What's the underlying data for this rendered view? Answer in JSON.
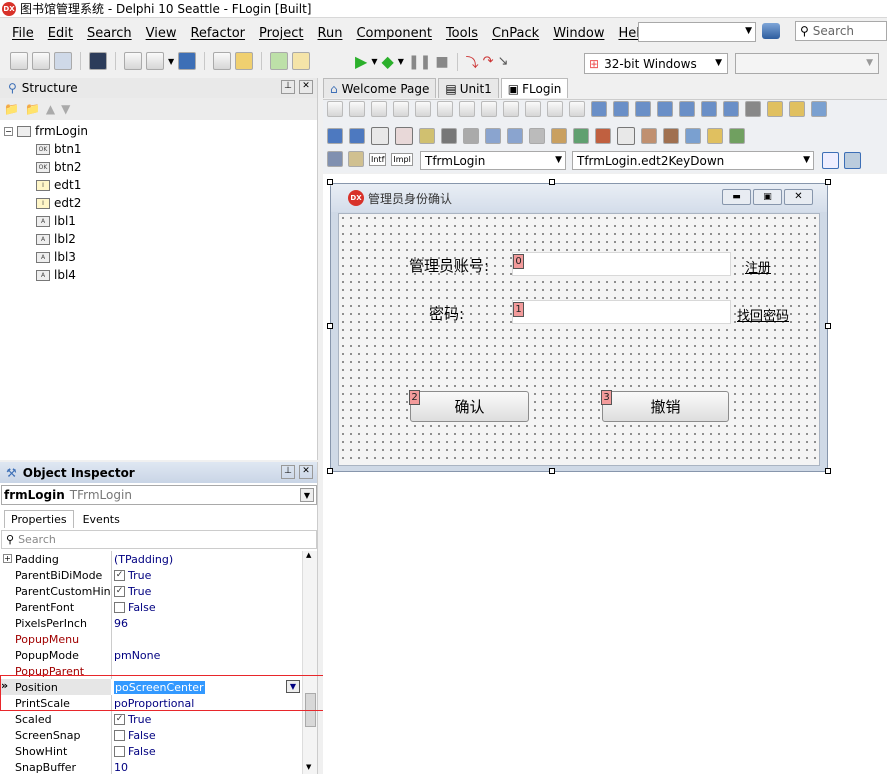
{
  "window": {
    "title": "图书馆管理系统 - Delphi 10 Seattle - FLogin [Built]",
    "app_icon_text": "DX"
  },
  "menu": [
    "File",
    "Edit",
    "Search",
    "View",
    "Refactor",
    "Project",
    "Run",
    "Component",
    "Tools",
    "CnPack",
    "Window",
    "Help"
  ],
  "search": {
    "placeholder": "Search"
  },
  "platform": {
    "selected": "32-bit Windows"
  },
  "structure": {
    "title": "Structure",
    "root": "frmLogin",
    "children": [
      {
        "name": "btn1",
        "icon": "OK"
      },
      {
        "name": "btn2",
        "icon": "OK"
      },
      {
        "name": "edt1",
        "icon": "I"
      },
      {
        "name": "edt2",
        "icon": "I"
      },
      {
        "name": "lbl1",
        "icon": "A"
      },
      {
        "name": "lbl2",
        "icon": "A"
      },
      {
        "name": "lbl3",
        "icon": "A"
      },
      {
        "name": "lbl4",
        "icon": "A"
      }
    ]
  },
  "object_inspector": {
    "title": "Object Inspector",
    "selected_object": "frmLogin",
    "selected_type": "TFrmLogin",
    "tabs": [
      "Properties",
      "Events"
    ],
    "search_placeholder": "Search",
    "properties": [
      {
        "name": "Padding",
        "value": "(TPadding)",
        "kind": "expand"
      },
      {
        "name": "ParentBiDiMode",
        "value": "True",
        "kind": "check",
        "checked": true
      },
      {
        "name": "ParentCustomHint",
        "value": "True",
        "kind": "check",
        "checked": true
      },
      {
        "name": "ParentFont",
        "value": "False",
        "kind": "check",
        "checked": false
      },
      {
        "name": "PixelsPerInch",
        "value": "96",
        "kind": "text"
      },
      {
        "name": "PopupMenu",
        "value": "",
        "kind": "ref"
      },
      {
        "name": "PopupMode",
        "value": "pmNone",
        "kind": "text"
      },
      {
        "name": "PopupParent",
        "value": "",
        "kind": "ref"
      },
      {
        "name": "Position",
        "value": "poScreenCenter",
        "kind": "selected"
      },
      {
        "name": "PrintScale",
        "value": "poProportional",
        "kind": "text"
      },
      {
        "name": "Scaled",
        "value": "True",
        "kind": "check",
        "checked": true
      },
      {
        "name": "ScreenSnap",
        "value": "False",
        "kind": "check",
        "checked": false
      },
      {
        "name": "ShowHint",
        "value": "False",
        "kind": "check",
        "checked": false
      },
      {
        "name": "SnapBuffer",
        "value": "10",
        "kind": "text"
      }
    ]
  },
  "editor": {
    "tabs": [
      "Welcome Page",
      "Unit1",
      "FLogin"
    ],
    "active_tab": "FLogin",
    "class_combo": "TfrmLogin",
    "method_combo": "TfrmLogin.edt2KeyDown"
  },
  "form": {
    "caption": "管理员身份确认",
    "label_account": "管理员账号:",
    "label_password": "密码:",
    "link_register": "注册",
    "link_recover": "找回密码",
    "btn_confirm": "确认",
    "btn_cancel": "撤销",
    "tab_orders": [
      "0",
      "1",
      "2",
      "3"
    ]
  },
  "colors": {
    "annotation": "#e8272b",
    "accent": "#1a73c8"
  }
}
